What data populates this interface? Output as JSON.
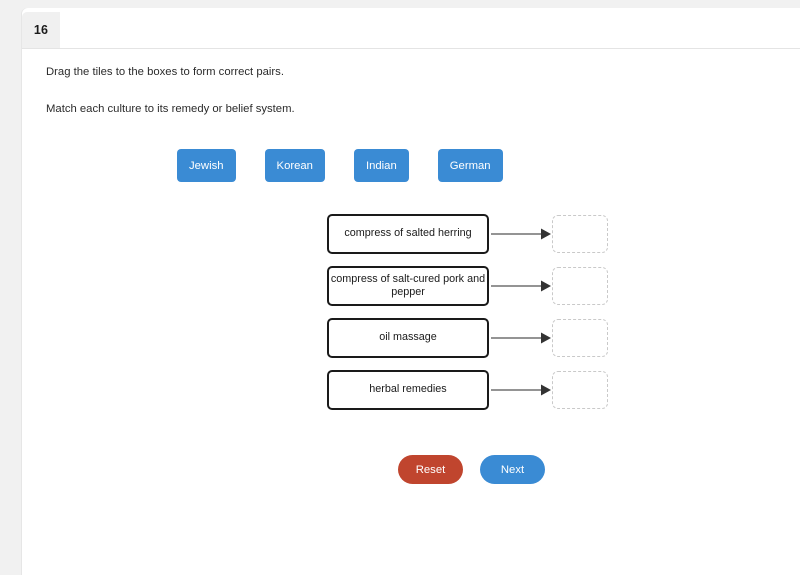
{
  "header": {
    "question_number": "16"
  },
  "instructions": {
    "line1": "Drag the tiles to the boxes to form correct pairs.",
    "line2": "Match each culture to its remedy or belief system."
  },
  "tiles": [
    {
      "label": "Jewish"
    },
    {
      "label": "Korean"
    },
    {
      "label": "Indian"
    },
    {
      "label": "German"
    }
  ],
  "match_rows": [
    {
      "prompt": "compress of salted herring",
      "answer": ""
    },
    {
      "prompt": "compress of salt-cured pork and pepper",
      "answer": ""
    },
    {
      "prompt": "oil massage",
      "answer": ""
    },
    {
      "prompt": "herbal remedies",
      "answer": ""
    }
  ],
  "buttons": {
    "reset_label": "Reset",
    "next_label": "Next"
  },
  "colors": {
    "tile_blue": "#3a8bd4",
    "reset_red": "#c0452e",
    "next_blue": "#3a8bd4",
    "page_background": "#f1f1f1",
    "card_background": "#ffffff",
    "prompt_border": "#1a1a1a",
    "drop_border": "#c9c9c9",
    "arrow": "#555555"
  }
}
